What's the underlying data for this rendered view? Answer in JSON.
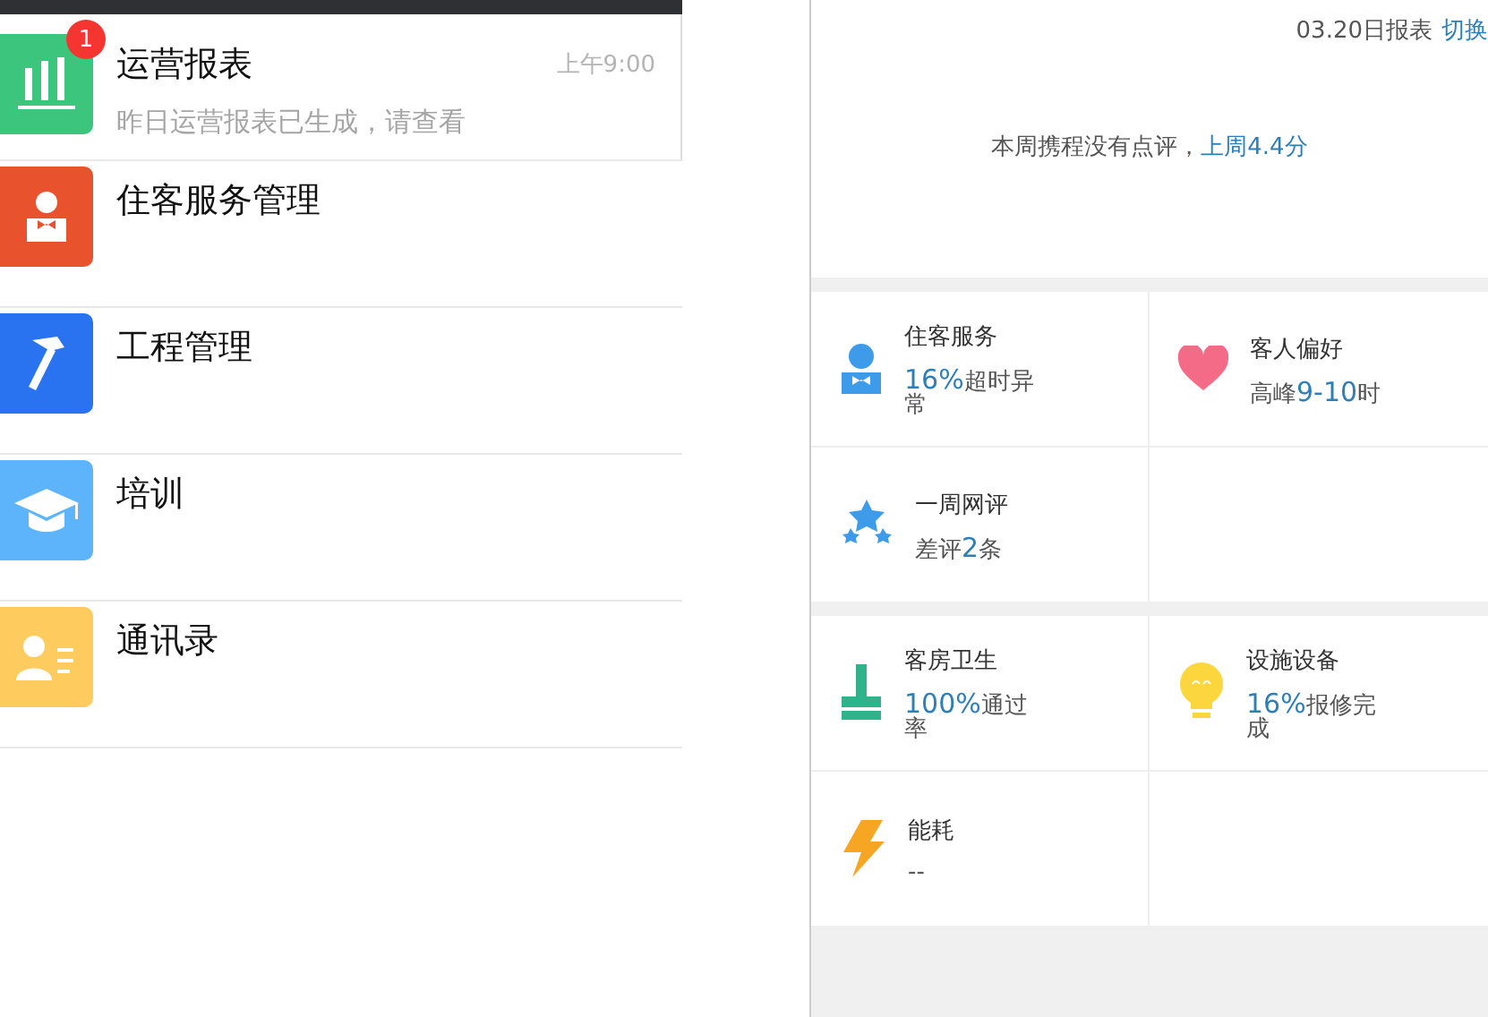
{
  "chat_list": {
    "items": [
      {
        "kind": "report",
        "title": "运营报表",
        "time": "上午9:00",
        "preview": "昨日运营报表已生成，请查看",
        "badge": "1",
        "color": "#3cc67d"
      },
      {
        "kind": "service",
        "title": "住客服务管理",
        "color": "#e8532e"
      },
      {
        "kind": "engineering",
        "title": "工程管理",
        "color": "#2a73f0"
      },
      {
        "kind": "training",
        "title": "培训",
        "color": "#5eb4fb"
      },
      {
        "kind": "contacts",
        "title": "通讯录",
        "color": "#fecc5e"
      }
    ]
  },
  "report": {
    "date": "03.20日报表",
    "switch_link": "切换",
    "review_note": "本周携程没有点评，",
    "review_link": "上周4.4分",
    "sections": [
      [
        {
          "kind": "service",
          "title": "住客服务",
          "parts": [
            {
              "text": "16%",
              "emphasis": true
            },
            {
              "text": "超时异常",
              "emphasis": false
            }
          ]
        },
        {
          "kind": "preference",
          "title": "客人偏好",
          "parts": [
            {
              "text": "高峰",
              "emphasis": false
            },
            {
              "text": "9-10",
              "emphasis": true
            },
            {
              "text": "时",
              "emphasis": false
            }
          ]
        },
        {
          "kind": "reviews",
          "title": "一周网评",
          "parts": [
            {
              "text": "差评",
              "emphasis": false
            },
            {
              "text": "2",
              "emphasis": true
            },
            {
              "text": "条",
              "emphasis": false
            }
          ]
        }
      ],
      [
        {
          "kind": "housekeeping",
          "title": "客房卫生",
          "parts": [
            {
              "text": "100%",
              "emphasis": true
            },
            {
              "text": "通过率",
              "emphasis": false
            }
          ]
        },
        {
          "kind": "facilities",
          "title": "设施设备",
          "parts": [
            {
              "text": "16%",
              "emphasis": true
            },
            {
              "text": "报修完成",
              "emphasis": false
            }
          ]
        },
        {
          "kind": "energy",
          "title": "能耗",
          "parts": [
            {
              "text": "--",
              "emphasis": false
            }
          ]
        }
      ]
    ]
  }
}
